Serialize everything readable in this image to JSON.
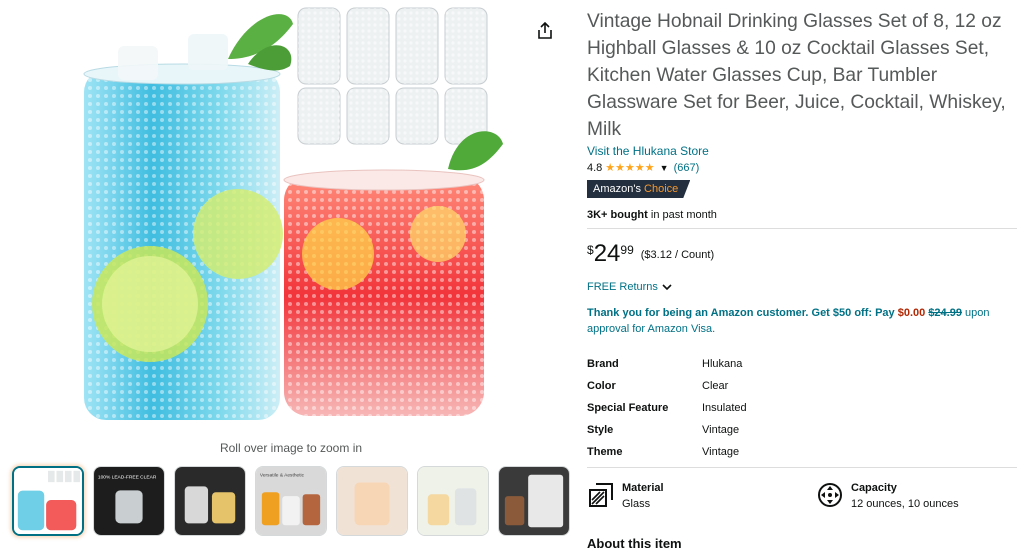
{
  "product": {
    "title": "Vintage Hobnail Drinking Glasses Set of 8, 12 oz Highball Glasses & 10 oz Cocktail Glasses Set, Kitchen Water Glasses Cup, Bar Tumbler Glassware Set for Beer, Juice, Cocktail, Whiskey, Milk",
    "store_link": "Visit the Hlukana Store",
    "rating": "4.8",
    "stars": 4.8,
    "rating_count": "(667)",
    "badge": {
      "prefix": "Amazon's",
      "accent": "Choice"
    },
    "bought": {
      "bold": "3K+ bought",
      "rest": " in past month"
    }
  },
  "price": {
    "currency": "$",
    "whole": "24",
    "fraction": "99",
    "unit_price": "($3.12 / Count)"
  },
  "returns": {
    "label": "FREE Returns"
  },
  "promo": {
    "bold_lead": "Thank you for being an Amazon customer. Get $50 off: Pay ",
    "pay_amount": "$0.00",
    "strike_amount": "$24.99",
    "tail": " upon approval for Amazon Visa."
  },
  "specs": [
    {
      "key": "Brand",
      "value": "Hlukana"
    },
    {
      "key": "Color",
      "value": "Clear"
    },
    {
      "key": "Special Feature",
      "value": "Insulated"
    },
    {
      "key": "Style",
      "value": "Vintage"
    },
    {
      "key": "Theme",
      "value": "Vintage"
    }
  ],
  "features": [
    {
      "name": "Material",
      "value": "Glass",
      "icon": "material-icon"
    },
    {
      "name": "Capacity",
      "value": "12 ounces, 10 ounces",
      "icon": "capacity-icon"
    }
  ],
  "media": {
    "zoom_hint": "Roll over image to zoom in",
    "thumbnails": [
      {
        "label": ""
      },
      {
        "label": "100% LEAD-FREE CLEAR"
      },
      {
        "label": ""
      },
      {
        "label": "Versatile & Aesthetic"
      },
      {
        "label": ""
      },
      {
        "label": ""
      },
      {
        "label": ""
      }
    ]
  },
  "about_heading": "About this item",
  "colors": {
    "link": "#007185",
    "star": "#FFA41C",
    "badge_bg": "#232F3E",
    "badge_accent": "#F69931",
    "price_red": "#B12704",
    "muted": "#565959"
  }
}
